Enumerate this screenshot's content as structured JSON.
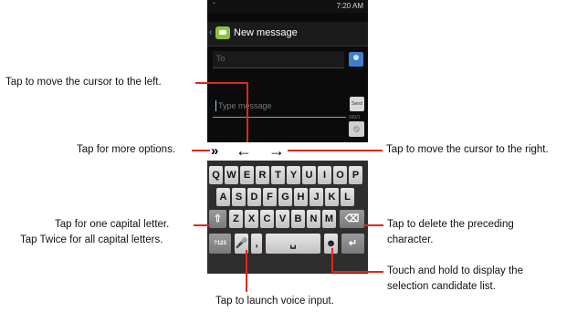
{
  "status": {
    "time": "7:20 AM"
  },
  "header": {
    "title": "New message"
  },
  "compose": {
    "to_placeholder": "To",
    "message_placeholder": "Type message",
    "send_label": "Send",
    "counter": "160/1"
  },
  "toolbar": {
    "more": "»",
    "left": "←",
    "right": "→"
  },
  "keyboard": {
    "row1": [
      "Q",
      "W",
      "E",
      "R",
      "T",
      "Y",
      "U",
      "I",
      "O",
      "P"
    ],
    "row2": [
      "A",
      "S",
      "D",
      "F",
      "G",
      "H",
      "J",
      "K",
      "L"
    ],
    "row3": [
      "Z",
      "X",
      "C",
      "V",
      "B",
      "N",
      "M"
    ],
    "shift": "⇧",
    "delete": "⌫",
    "symbols": "?123",
    "mic": "🎤",
    "comma": ",",
    "space": "␣",
    "emoji": "☻",
    "enter": "↵"
  },
  "callouts": {
    "cursor_left": "Tap to move the cursor to the left.",
    "more_options": "Tap for more options.",
    "cursor_right": "Tap to move the cursor to the right.",
    "capital_one": "Tap for one capital letter.",
    "capital_all": "Tap Twice for all capital letters.",
    "delete_line1": "Tap to delete the preceding",
    "delete_line2": "character.",
    "candidate_line1": "Touch and hold to display the",
    "candidate_line2": "selection candidate list.",
    "voice": "Tap to launch voice input."
  }
}
